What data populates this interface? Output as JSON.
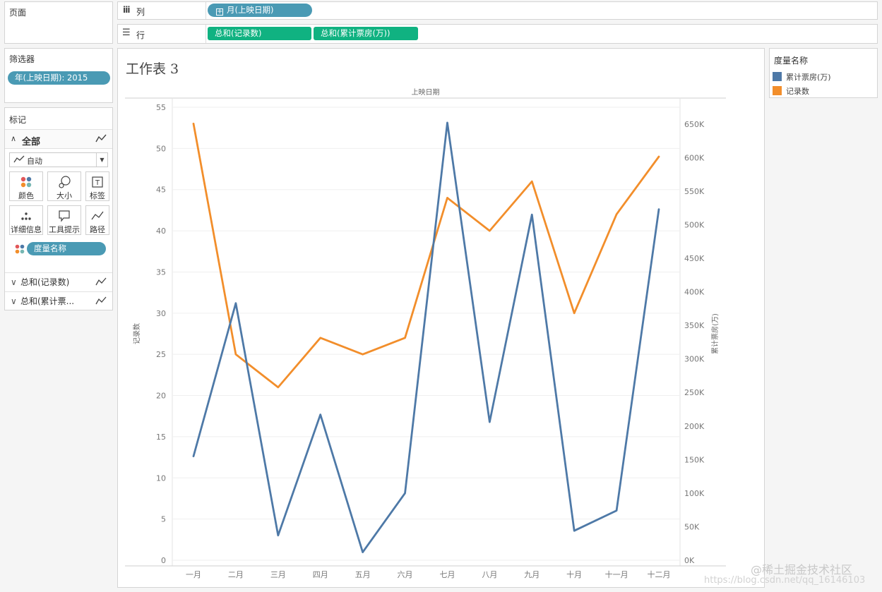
{
  "pages_panel": {
    "title": "页面"
  },
  "columns_shelf": {
    "icon": "columns-icon",
    "label": "列",
    "pills": [
      "月(上映日期)"
    ]
  },
  "rows_shelf": {
    "icon": "rows-icon",
    "label": "行",
    "pills": [
      "总和(记录数)",
      "总和(累计票房(万))"
    ]
  },
  "filters_panel": {
    "title": "筛选器",
    "pills": [
      "年(上映日期): 2015"
    ]
  },
  "marks_panel": {
    "title": "标记",
    "all_label": "全部",
    "mark_type": "自动",
    "buttons": [
      {
        "icon": "color-icon",
        "label": "颜色"
      },
      {
        "icon": "size-icon",
        "label": "大小"
      },
      {
        "icon": "label-icon",
        "label": "标签"
      },
      {
        "icon": "detail-icon",
        "label": "详细信息"
      },
      {
        "icon": "tooltip-icon",
        "label": "工具提示"
      },
      {
        "icon": "path-icon",
        "label": "路径"
      }
    ],
    "field_pill": "度量名称",
    "measure_rows": [
      "总和(记录数)",
      "总和(累计票..."
    ]
  },
  "worksheet": {
    "title": "工作表 3"
  },
  "legend": {
    "title": "度量名称",
    "items": [
      {
        "label": "累计票房(万)",
        "color": "#4e79a7"
      },
      {
        "label": "记录数",
        "color": "#f28e2b"
      }
    ]
  },
  "chart_data": {
    "type": "line",
    "header": "上映日期",
    "categories": [
      "一月",
      "二月",
      "三月",
      "四月",
      "五月",
      "六月",
      "七月",
      "八月",
      "九月",
      "十月",
      "十一月",
      "十二月"
    ],
    "y_left": {
      "label": "记录数",
      "ylim": [
        0,
        55
      ],
      "ticks": [
        0,
        5,
        10,
        15,
        20,
        25,
        30,
        35,
        40,
        45,
        50,
        55
      ]
    },
    "y_right": {
      "label": "累计票房(万)",
      "ylim": [
        0,
        675000
      ],
      "ticks": [
        "0K",
        "50K",
        "100K",
        "150K",
        "200K",
        "250K",
        "300K",
        "350K",
        "400K",
        "450K",
        "500K",
        "550K",
        "600K",
        "650K"
      ]
    },
    "series": [
      {
        "name": "记录数",
        "axis": "left",
        "color": "#f28e2b",
        "values": [
          53,
          25,
          21,
          27,
          25,
          27,
          44,
          40,
          46,
          30,
          42,
          49
        ]
      },
      {
        "name": "累计票房(万)",
        "axis": "right",
        "color": "#4e79a7",
        "values": [
          155000,
          383000,
          37000,
          217000,
          12000,
          100000,
          652000,
          206000,
          515000,
          44000,
          74000,
          523000
        ]
      }
    ],
    "grid": true,
    "legend_position": "right"
  },
  "watermark": {
    "line1": "@稀土掘金技术社区",
    "line2": "https://blog.csdn.net/qq_16146103"
  }
}
